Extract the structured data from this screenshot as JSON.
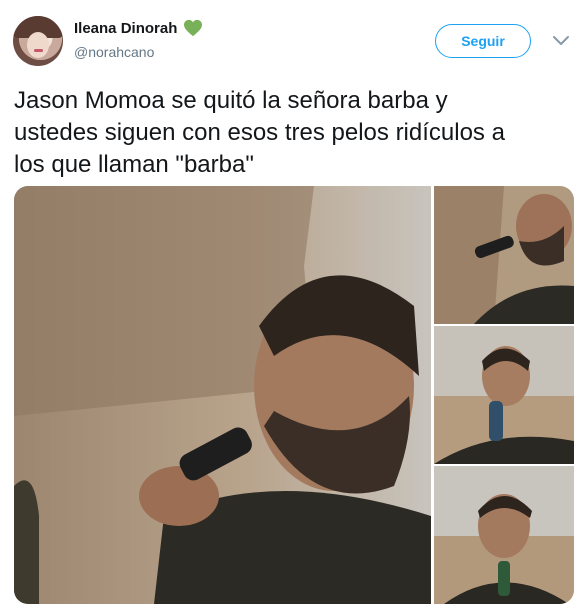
{
  "tweet": {
    "author_name": "Ileana Dinorah",
    "author_handle": "@norahcano",
    "follow_label": "Seguir",
    "text": "Jason Momoa se quitó la señora barba y\nustedes siguen con esos tres pelos ridículos a\nlos que llaman \"barba\"",
    "icons": [
      "green-heart-emoji",
      "chevron-down-icon"
    ],
    "colors": {
      "accent": "#1da1f2",
      "heart": "#78b159",
      "text": "#14171a",
      "secondary": "#657786"
    }
  },
  "media": {
    "photo_count": 4
  }
}
